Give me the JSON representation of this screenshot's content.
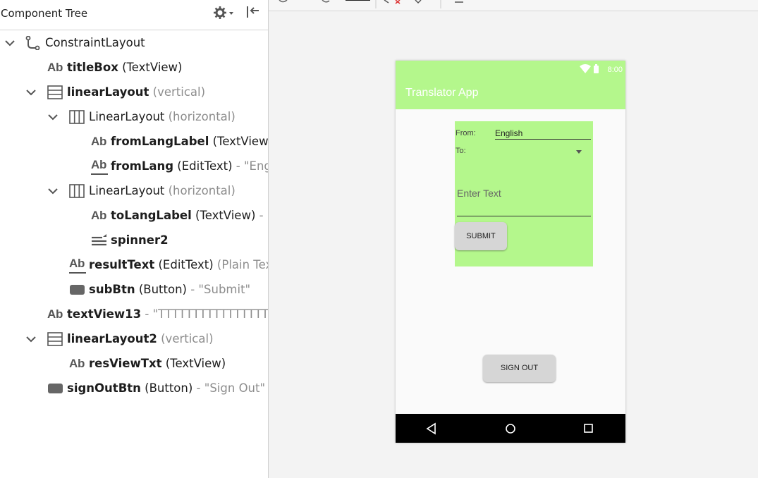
{
  "panel": {
    "title": "Component Tree",
    "gear_icon": "gear-dropdown-icon",
    "collapse_icon": "collapse-panel-icon"
  },
  "tree": [
    {
      "name": "ConstraintLayout",
      "type": "",
      "extra": "",
      "icon": "constraint-layout-icon",
      "bold": false
    },
    {
      "name": "titleBox",
      "type": " (TextView)",
      "extra": "",
      "icon": "textview-icon",
      "bold": true
    },
    {
      "name": "linearLayout",
      "type": "",
      "extra": " (vertical)",
      "icon": "linear-vertical-icon",
      "bold": true
    },
    {
      "name": "LinearLayout",
      "type": "",
      "extra": " (horizontal)",
      "icon": "linear-horizontal-icon",
      "bold": false
    },
    {
      "name": "fromLangLabel",
      "type": " (TextView)",
      "extra": " - ",
      "icon": "textview-icon",
      "bold": true
    },
    {
      "name": "fromLang",
      "type": " (EditText)",
      "extra": " - \"Englis",
      "icon": "edittext-icon",
      "bold": true
    },
    {
      "name": "LinearLayout",
      "type": "",
      "extra": " (horizontal)",
      "icon": "linear-horizontal-icon",
      "bold": false
    },
    {
      "name": "toLangLabel",
      "type": " (TextView)",
      "extra": " - \"To",
      "icon": "textview-icon",
      "bold": true
    },
    {
      "name": "spinner2",
      "type": "",
      "extra": "",
      "icon": "spinner-icon",
      "bold": true
    },
    {
      "name": "resultText",
      "type": " (EditText)",
      "extra": " (Plain Text)",
      "icon": "edittext-icon",
      "bold": true
    },
    {
      "name": "subBtn",
      "type": " (Button)",
      "extra": " - \"Submit\"",
      "icon": "button-icon",
      "bold": true
    },
    {
      "name": "textView13",
      "type": "",
      "extra": " - \"TTTTTTTTTTTTTTTT",
      "icon": "textview-icon",
      "bold": true
    },
    {
      "name": "linearLayout2",
      "type": "",
      "extra": " (vertical)",
      "icon": "linear-vertical-icon",
      "bold": true
    },
    {
      "name": "resViewTxt",
      "type": " (TextView)",
      "extra": "",
      "icon": "textview-icon",
      "bold": true
    },
    {
      "name": "signOutBtn",
      "type": " (Button)",
      "extra": " - \"Sign Out\"",
      "icon": "button-icon",
      "bold": true
    }
  ],
  "icon_text": {
    "ab": "Ab"
  },
  "phone": {
    "status_time": "8:00",
    "app_title": "Translator App",
    "from_label": "From:",
    "from_value": "English",
    "to_label": "To:",
    "enter_text_hint": "Enter Text",
    "submit_label": "SUBMIT",
    "signout_label": "SIGN OUT"
  },
  "colors": {
    "appbar": "#b4f78c",
    "layout_bg": "#b4f78c",
    "navbar": "#000000",
    "button": "#d6d6d6"
  }
}
